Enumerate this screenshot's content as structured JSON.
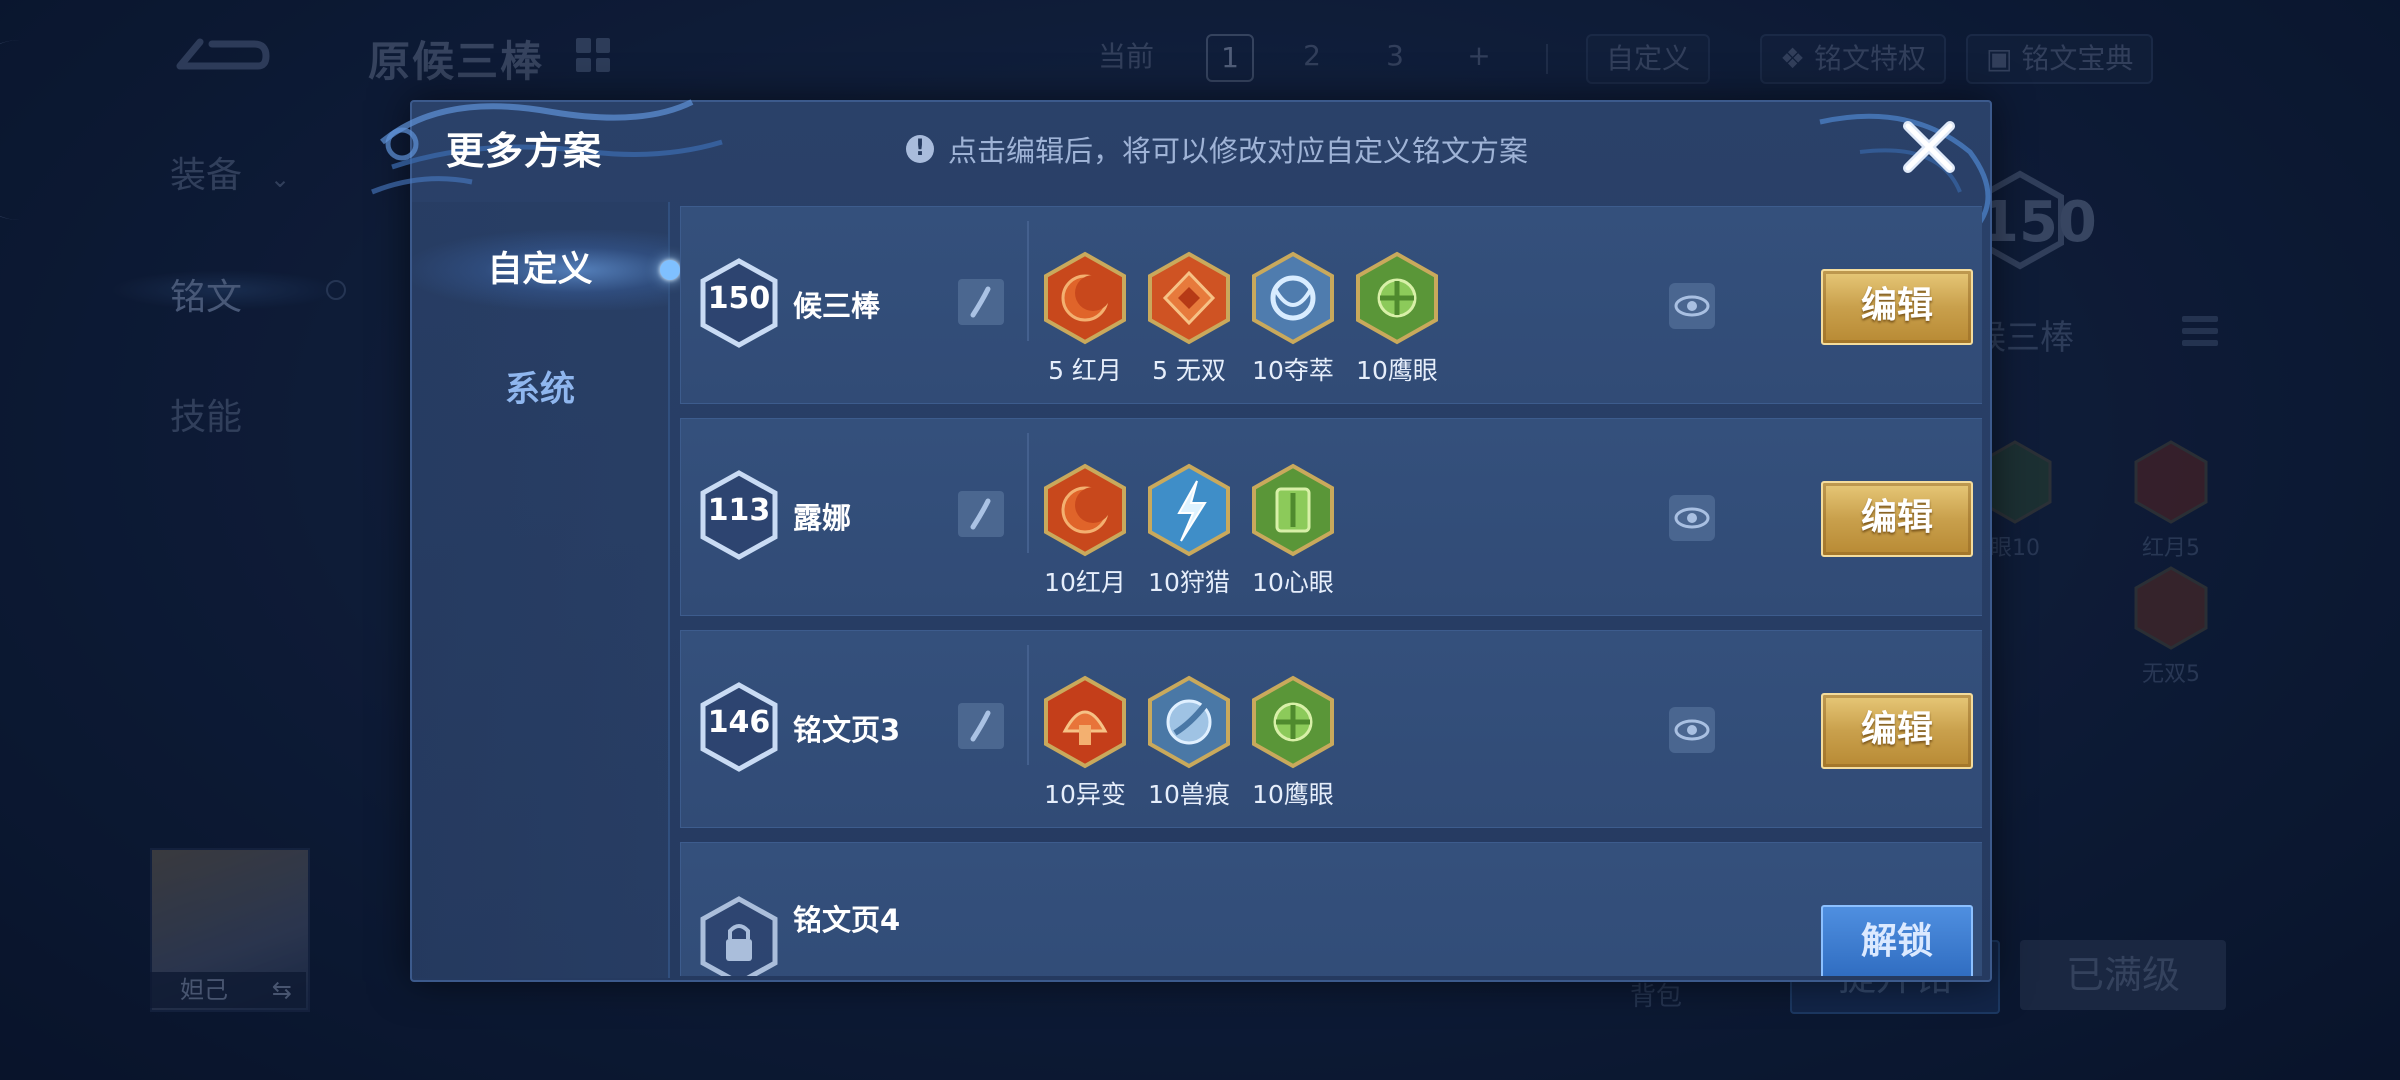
{
  "background": {
    "title": "原候三棒",
    "nav": [
      "装备",
      "铭文",
      "技能"
    ],
    "current_label": "当前",
    "page_numbers": [
      "1",
      "2",
      "3"
    ],
    "add_label": "+",
    "custom_label": "自定义",
    "privilege_label": "铭文特权",
    "codex_label": "铭文宝典",
    "level": "150",
    "hero_label": "候三棒",
    "side_runes": [
      {
        "label": "眼10",
        "color": "#4d7a3a",
        "icon": "hawk-eye-rune-icon"
      },
      {
        "label": "红月5",
        "color": "#b43a1e",
        "icon": "red-moon-rune-icon"
      },
      {
        "label": "无双5",
        "color": "#b44a20",
        "icon": "peerless-rune-icon"
      }
    ],
    "hero_name": "妲己",
    "bag_label": "背包",
    "enhance_label": "提升铭",
    "maxed_label": "已满级"
  },
  "modal": {
    "title": "更多方案",
    "hint": "点击编辑后，将可以修改对应自定义铭文方案",
    "tabs": [
      "自定义",
      "系统"
    ],
    "rows": [
      {
        "level": "150",
        "name": "候三棒",
        "runes": [
          {
            "label": "5 红月",
            "icon": "red-moon-rune-icon",
            "color": "#d2501e"
          },
          {
            "label": "5 无双",
            "icon": "peerless-rune-icon",
            "color": "#d35a22"
          },
          {
            "label": "10夺萃",
            "icon": "seize-rune-icon",
            "color": "#5a86b8"
          },
          {
            "label": "10鹰眼",
            "icon": "hawk-eye-rune-icon",
            "color": "#5d9a3a"
          }
        ],
        "action": "编辑"
      },
      {
        "level": "113",
        "name": "露娜",
        "runes": [
          {
            "label": "10红月",
            "icon": "red-moon-rune-icon",
            "color": "#d2501e"
          },
          {
            "label": "10狩猎",
            "icon": "hunt-rune-icon",
            "color": "#3f8ec8"
          },
          {
            "label": "10心眼",
            "icon": "mind-eye-rune-icon",
            "color": "#5d9a3a"
          }
        ],
        "action": "编辑"
      },
      {
        "level": "146",
        "name": "铭文页3",
        "runes": [
          {
            "label": "10异变",
            "icon": "mutation-rune-icon",
            "color": "#c9401c"
          },
          {
            "label": "10兽痕",
            "icon": "beast-mark-rune-icon",
            "color": "#4e7fae"
          },
          {
            "label": "10鹰眼",
            "icon": "hawk-eye-rune-icon",
            "color": "#5d9a3a"
          }
        ],
        "action": "编辑"
      },
      {
        "name": "铭文页4",
        "locked": true,
        "action": "解锁"
      }
    ]
  }
}
